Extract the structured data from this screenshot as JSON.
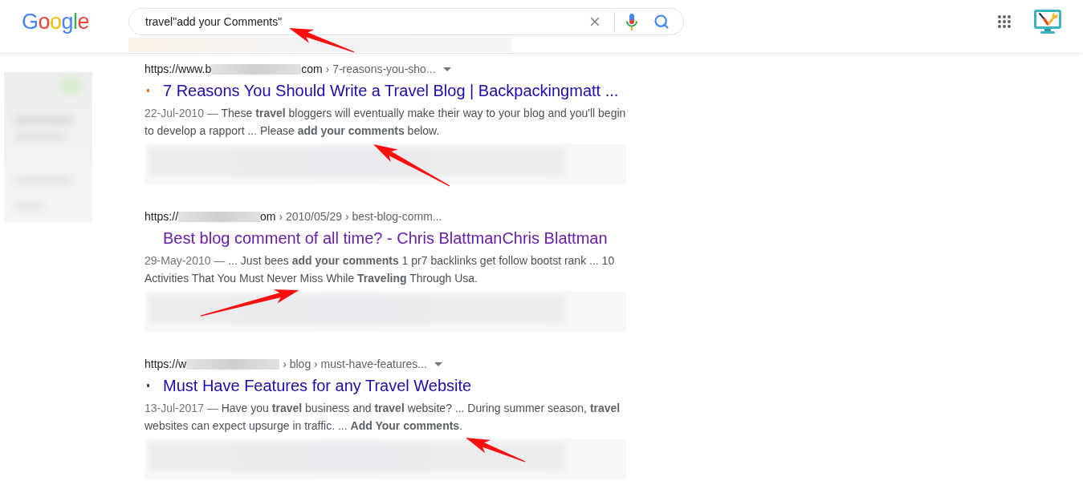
{
  "header": {
    "logo": "Google",
    "search": {
      "value": "travel\"add your Comments\""
    }
  },
  "results": [
    {
      "url_start": "https://www.b",
      "url_end": "com",
      "breadcrumb": "› 7-reasons-you-sho...",
      "has_menu": true,
      "color": "#e8710a",
      "title": "7 Reasons You Should Write a Travel Blog | Backpackingmatt ...",
      "visited": false,
      "date": "22-Jul-2010 —",
      "snippet": "These **travel** bloggers will eventually make their way to your blog and you'll begin to develop a rapport ... Please **add your comments** below."
    },
    {
      "url_start": "https://",
      "url_end": "om",
      "breadcrumb": "› 2010/05/29 › best-blog-comm...",
      "has_menu": false,
      "title": "Best blog comment of all time? - Chris BlattmanChris Blattman",
      "visited": true,
      "date": "29-May-2010 —",
      "snippet": "... Just bees **add your comments** 1 pr7 backlinks get follow bootst rank ... 10 Activities That You Must Never Miss While **Traveling** Through Usa."
    },
    {
      "url_start": "https://w",
      "breadcrumb": "› blog › must-have-features...",
      "has_menu": true,
      "color": "#3c3c3c",
      "title": "Must Have Features for any Travel Website",
      "visited": false,
      "date": "13-Jul-2017 —",
      "snippet": "Have you **travel** business and **travel** website? ... During summer season, **travel** websites can expect upsurge in traffic. ... **Add Your comments**."
    }
  ]
}
